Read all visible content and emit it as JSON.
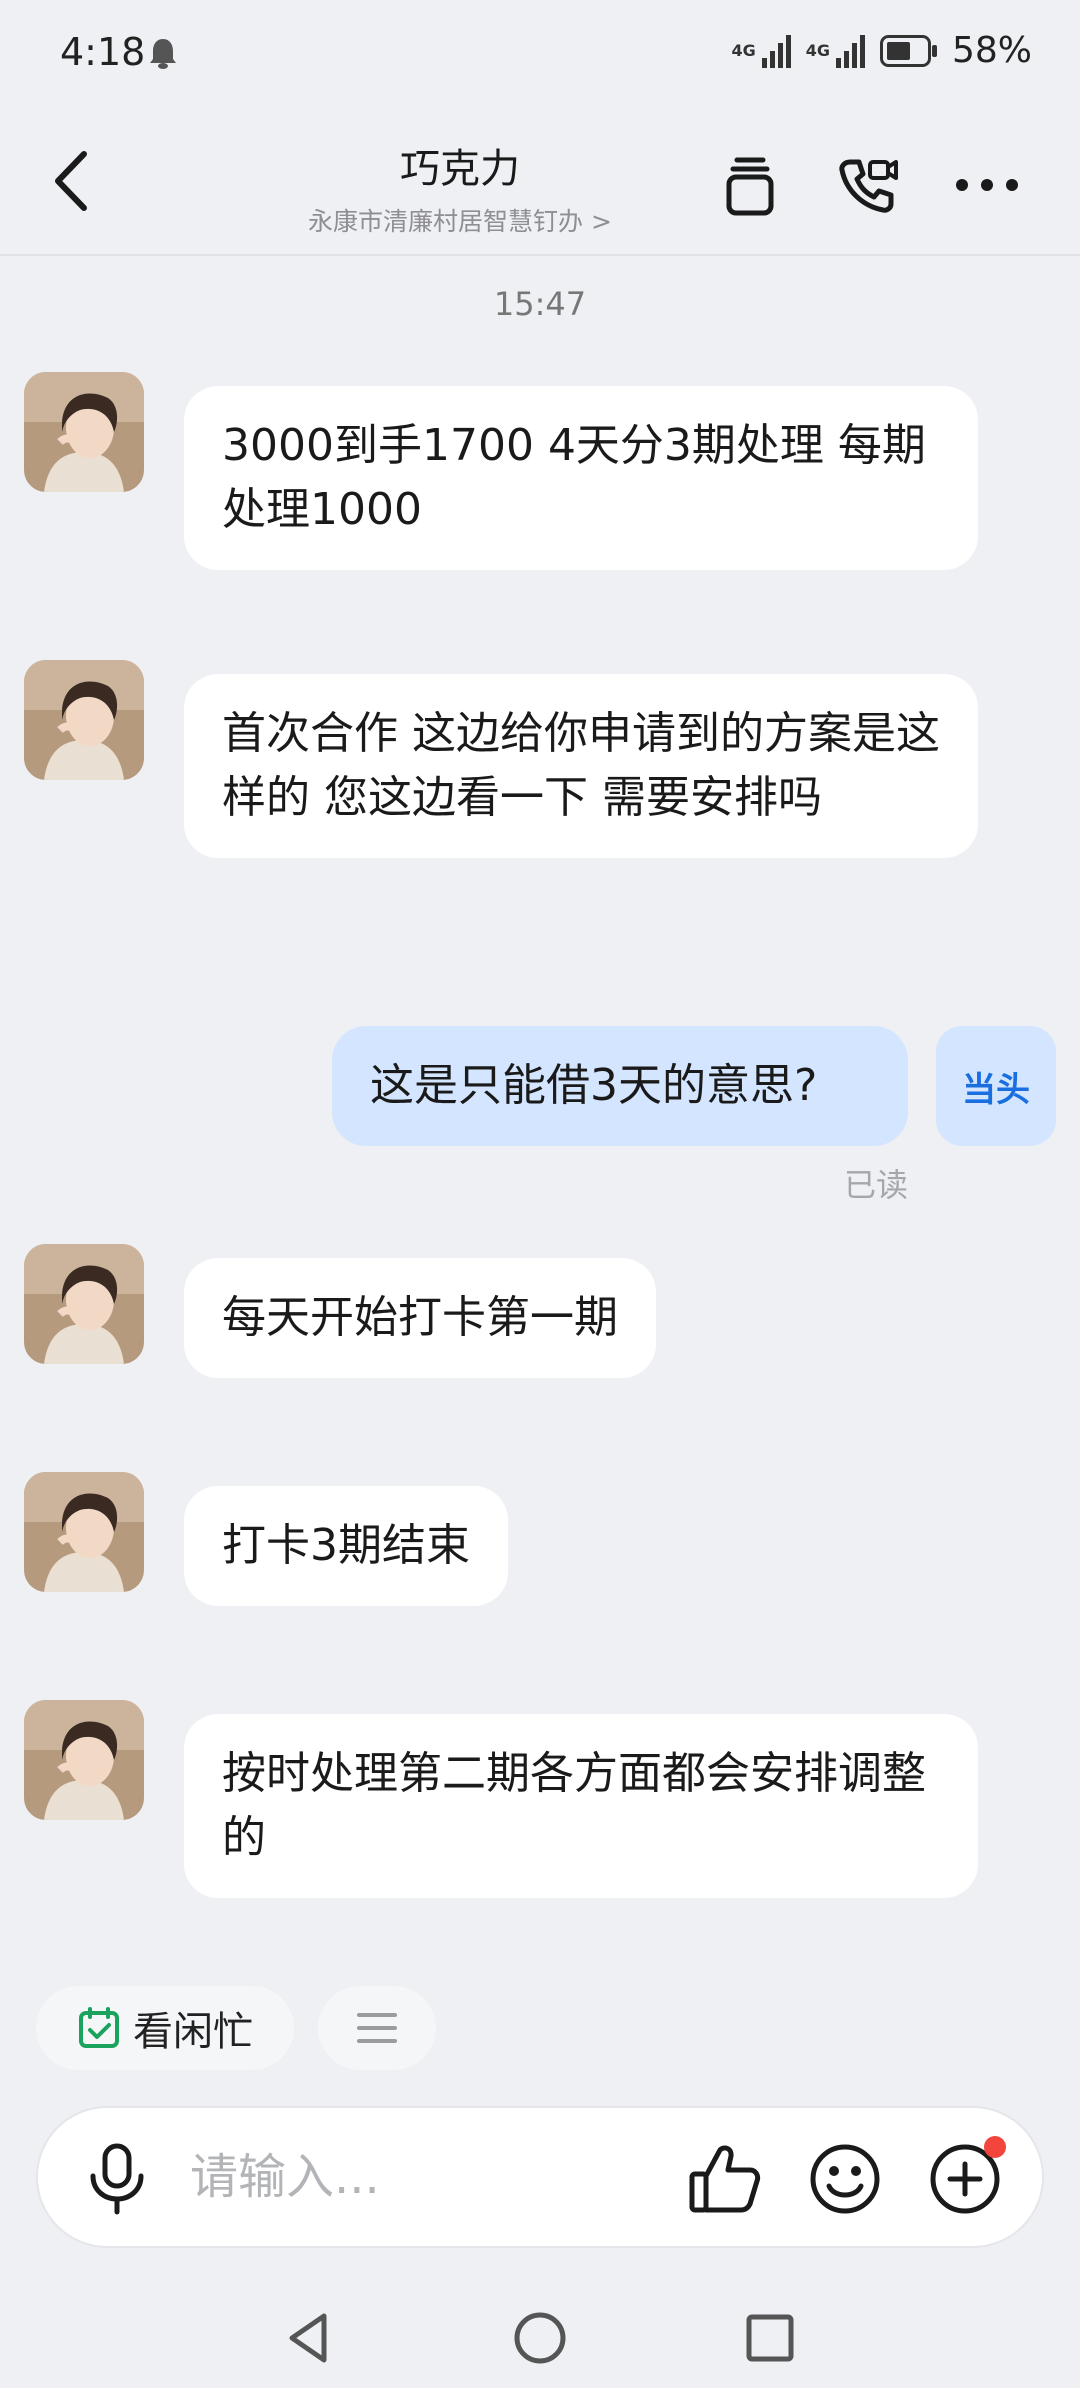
{
  "status_bar": {
    "time": "4:18",
    "net1": "4G",
    "net2": "4G",
    "battery": "58%"
  },
  "header": {
    "title": "巧克力",
    "subtitle": "永康市清廉村居智慧钉办",
    "subtitle_chevron": ">"
  },
  "chat": {
    "timestamp": "15:47",
    "messages": [
      {
        "from": "other",
        "text": "3000到手1700  4天分3期处理 每期处理1000"
      },
      {
        "from": "other",
        "text": "首次合作 这边给你申请到的方案是这样的 您这边看一下 需要安排吗"
      },
      {
        "from": "me",
        "text": "这是只能借3天的意思?"
      },
      {
        "from": "other",
        "text": "每天开始打卡第一期"
      },
      {
        "from": "other",
        "text": "打卡3期结束"
      },
      {
        "from": "other",
        "text": "按时处理第二期各方面都会安排调整的"
      }
    ],
    "my_avatar_label": "当头",
    "read_status": "已读"
  },
  "quick_actions": {
    "availability_label": "看闲忙"
  },
  "input": {
    "placeholder": "请输入..."
  },
  "colors": {
    "background": "#eef0f3",
    "my_bubble": "#d4e5ff",
    "accent_blue": "#1a6fe0",
    "notification_red": "#f2453d",
    "calendar_green": "#1aa35c"
  },
  "icons": {
    "back": "chevron-left-icon",
    "copy": "cards-icon",
    "call": "phone-video-icon",
    "more": "more-dots-icon",
    "mic": "microphone-icon",
    "like": "thumbs-up-icon",
    "emoji": "smiley-icon",
    "add": "plus-circle-icon"
  }
}
